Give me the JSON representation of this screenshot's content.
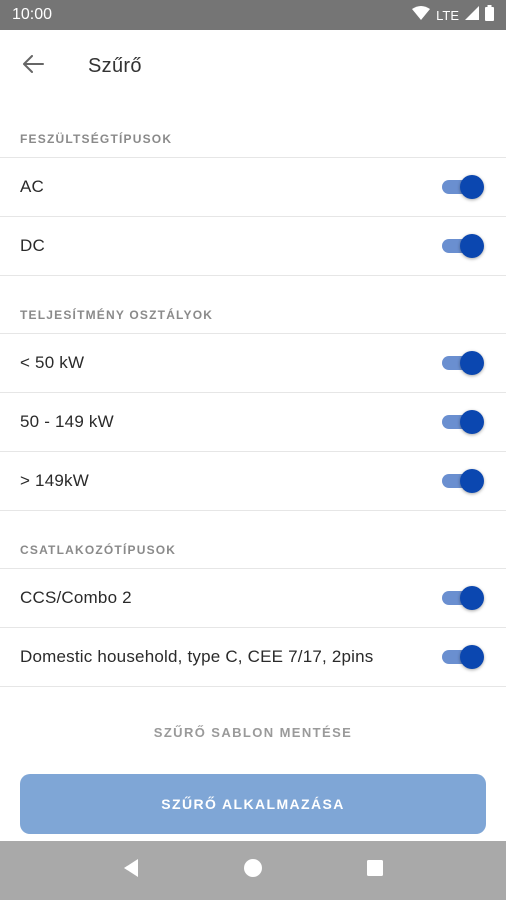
{
  "status_bar": {
    "time": "10:00",
    "network": "LTE",
    "icons": [
      "wifi-icon",
      "signal-icon",
      "battery-icon"
    ]
  },
  "app_bar": {
    "back_icon": "arrow-left-icon",
    "title": "Szűrő"
  },
  "sections": [
    {
      "header": "FESZÜLTSÉGTÍPUSOK",
      "items": [
        {
          "label": "AC",
          "enabled": true
        },
        {
          "label": "DC",
          "enabled": true
        }
      ]
    },
    {
      "header": "TELJESÍTMÉNY OSZTÁLYOK",
      "items": [
        {
          "label": "< 50 kW",
          "enabled": true
        },
        {
          "label": "50 - 149 kW",
          "enabled": true
        },
        {
          "label": "> 149kW",
          "enabled": true
        }
      ]
    },
    {
      "header": "CSATLAKOZÓTÍPUSOK",
      "items": [
        {
          "label": "CCS/Combo 2",
          "enabled": true
        },
        {
          "label": "Domestic household, type C, CEE 7/17, 2pins",
          "enabled": true
        }
      ]
    }
  ],
  "actions": {
    "save_template": "SZŰRŐ SABLON MENTÉSE",
    "apply": "SZŰRŐ ALKALMAZÁSA"
  },
  "colors": {
    "toggle_thumb": "#0b47b0",
    "toggle_track": "#6a8fd0",
    "apply_button": "#7fa6d6",
    "status_bar": "#757575",
    "nav_bar": "#a9a9a9"
  },
  "nav_bar": {
    "icons": [
      "back-triangle-icon",
      "home-circle-icon",
      "recents-square-icon"
    ]
  }
}
